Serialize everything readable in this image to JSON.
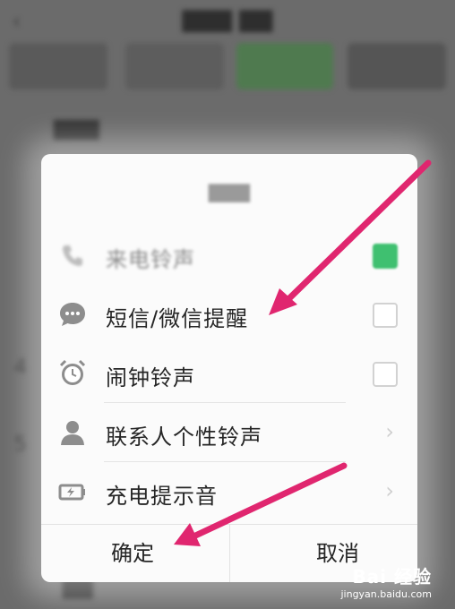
{
  "dialog": {
    "items": [
      {
        "label": "来电铃声",
        "control": "checkbox",
        "checked": true
      },
      {
        "label": "短信/微信提醒",
        "control": "checkbox",
        "checked": false
      },
      {
        "label": "闹钟铃声",
        "control": "checkbox",
        "checked": false
      },
      {
        "label": "联系人个性铃声",
        "control": "chevron"
      },
      {
        "label": "充电提示音",
        "control": "chevron"
      }
    ],
    "buttons": {
      "confirm": "确定",
      "cancel": "取消"
    }
  },
  "background": {
    "side_numbers": [
      "4",
      "5"
    ]
  },
  "watermark": {
    "brand": "Bai 经验",
    "url": "jingyan.baidu.com"
  },
  "colors": {
    "accent_green": "#3fc070",
    "arrow": "#e0266f",
    "overlay": "#6b6b6b"
  }
}
